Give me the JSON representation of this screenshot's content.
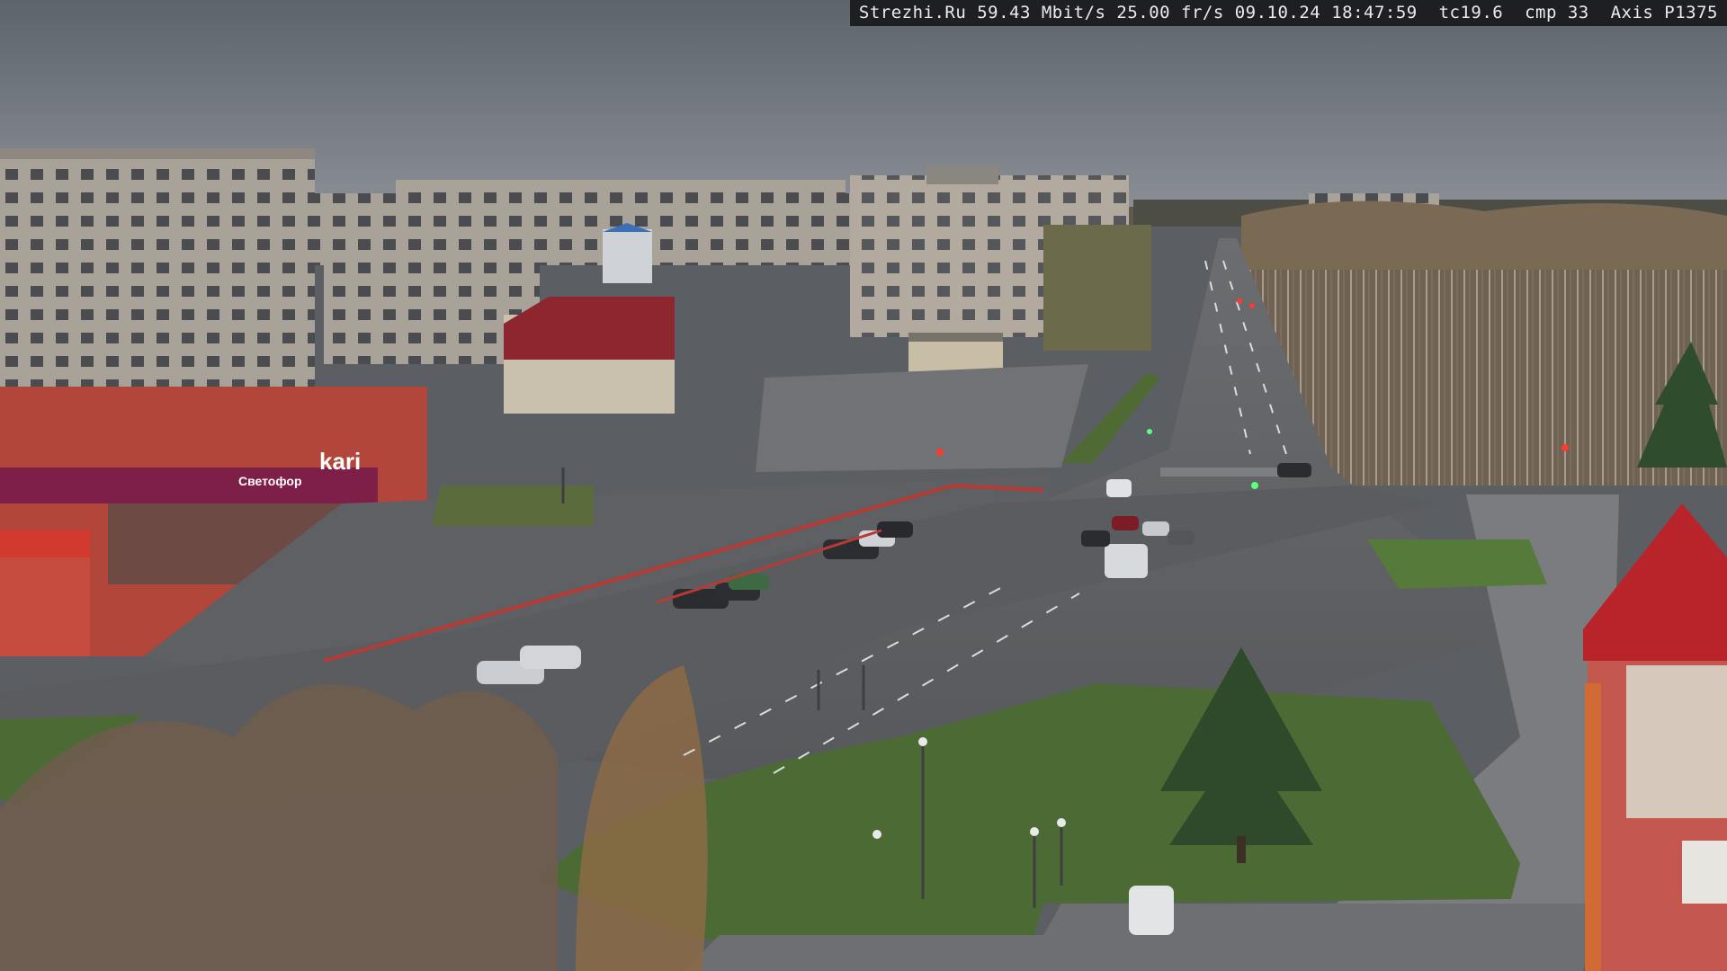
{
  "osd": {
    "text": "Strezhi.Ru 59.43 Mbit/s 25.00 fr/s 09.10.24 18:47:59  tc19.6  cmp 33  Axis P1375"
  },
  "signs": {
    "store_brand": "kari",
    "store_name": "Светофор"
  },
  "colors": {
    "sky": "#6d747c",
    "asphalt": "#5a5c5f",
    "grass": "#4c6b34",
    "brick_red": "#b2463b",
    "panel_building": "#a9a39a"
  }
}
